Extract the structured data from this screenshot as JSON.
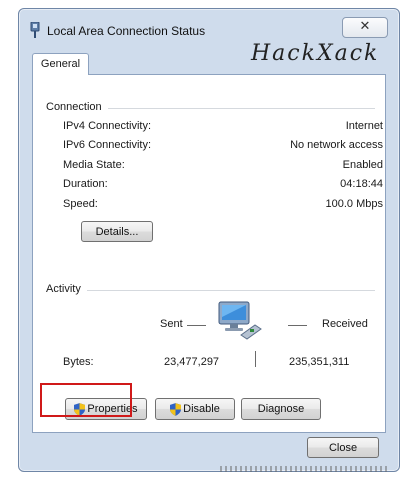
{
  "window": {
    "title": "Local Area Connection Status",
    "close_glyph": "✕",
    "watermark": "HackXack"
  },
  "tabs": [
    {
      "label": "General"
    }
  ],
  "connection": {
    "section_label": "Connection",
    "rows": [
      {
        "label": "IPv4 Connectivity:",
        "value": "Internet"
      },
      {
        "label": "IPv6 Connectivity:",
        "value": "No network access"
      },
      {
        "label": "Media State:",
        "value": "Enabled"
      },
      {
        "label": "Duration:",
        "value": "04:18:44"
      },
      {
        "label": "Speed:",
        "value": "100.0 Mbps"
      }
    ],
    "details_label": "Details..."
  },
  "activity": {
    "section_label": "Activity",
    "sent_label": "Sent",
    "received_label": "Received",
    "bytes_label": "Bytes:",
    "bytes_sent": "23,477,297",
    "bytes_received": "235,351,311",
    "icon": "network-computer-icon"
  },
  "buttons": {
    "properties_label": "Properties",
    "disable_label": "Disable",
    "diagnose_label": "Diagnose",
    "close_label": "Close"
  },
  "colors": {
    "highlight": "#d01919",
    "shield_blue": "#2f63c6",
    "shield_yellow": "#f2c21b"
  }
}
